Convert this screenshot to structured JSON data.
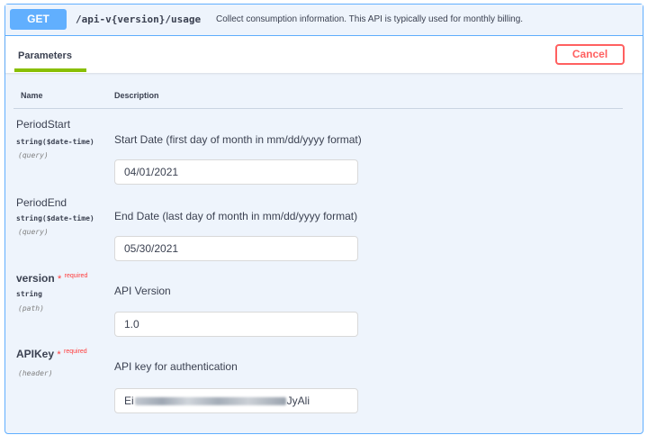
{
  "operation": {
    "method": "GET",
    "path": "/api-v{version}/usage",
    "summary": "Collect consumption information. This API is typically used for monthly billing."
  },
  "tabs": {
    "active": "Parameters"
  },
  "buttons": {
    "cancel": "Cancel"
  },
  "table": {
    "col_name": "Name",
    "col_description": "Description"
  },
  "params": [
    {
      "name": "PeriodStart",
      "required": false,
      "type": "string($date-time)",
      "in": "(query)",
      "description": "Start Date (first day of month in mm/dd/yyyy format)",
      "value": "04/01/2021"
    },
    {
      "name": "PeriodEnd",
      "required": false,
      "type": "string($date-time)",
      "in": "(query)",
      "description": "End Date (last day of month in mm/dd/yyyy format)",
      "value": "05/30/2021"
    },
    {
      "name": "version",
      "required": true,
      "type": "string",
      "in": "(path)",
      "description": "API Version",
      "value": "1.0"
    },
    {
      "name": "APIKey",
      "required": true,
      "type": "",
      "in": "(header)",
      "description": "API key for authentication",
      "value_prefix": "Ei",
      "value_suffix": "JyAli"
    }
  ],
  "labels": {
    "required_star": "*",
    "required": "required"
  },
  "colors": {
    "get_blue": "#61affe",
    "cancel_red": "#ff6060",
    "tab_green": "#89bf04",
    "panel_bg": "#eef4fc"
  }
}
